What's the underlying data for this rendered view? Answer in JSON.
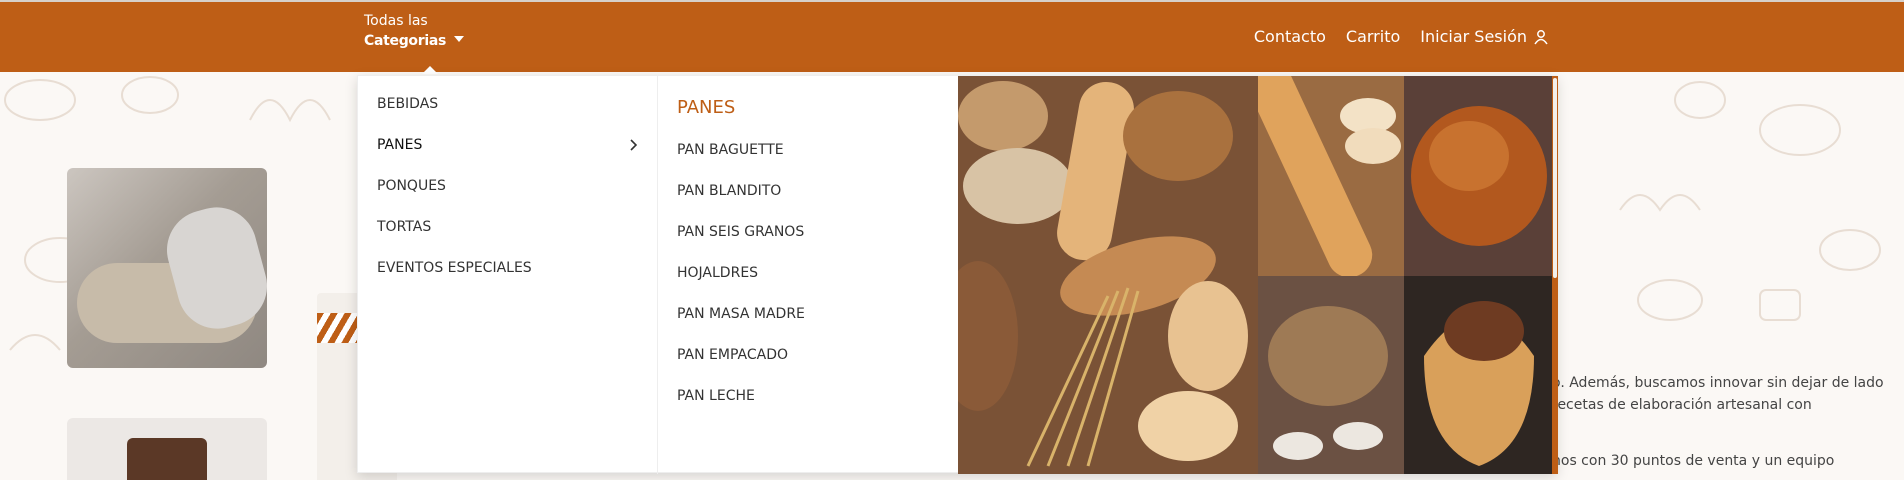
{
  "header": {
    "categories_line1": "Todas las",
    "categories_line2": "Categorias",
    "nav": [
      {
        "label": "Contacto"
      },
      {
        "label": "Carrito"
      },
      {
        "label": "Iniciar Sesión"
      }
    ]
  },
  "menu": {
    "categories": [
      {
        "label": "BEBIDAS"
      },
      {
        "label": "PANES"
      },
      {
        "label": "PONQUES"
      },
      {
        "label": "TORTAS"
      },
      {
        "label": "EVENTOS ESPECIALES"
      }
    ],
    "active_category": "PANES",
    "subheading": "PANES",
    "subitems": [
      {
        "label": "PAN BAGUETTE"
      },
      {
        "label": "PAN BLANDITO"
      },
      {
        "label": "PAN SEIS GRANOS"
      },
      {
        "label": "HOJALDRES"
      },
      {
        "label": "PAN MASA MADRE"
      },
      {
        "label": "PAN EMPACADO"
      },
      {
        "label": "PAN LECHE"
      }
    ]
  },
  "background": {
    "text_lines": [
      "o. Además, buscamos innovar sin dejar de lado",
      "recetas de elaboración artesanal con",
      "nos con 30 puntos de venta y un equipo"
    ]
  },
  "colors": {
    "brand": "#be5e16",
    "header_text": "#ffffff"
  },
  "icons": {
    "user": "user-icon",
    "caret": "caret-down-icon",
    "chevron": "chevron-right-icon"
  }
}
